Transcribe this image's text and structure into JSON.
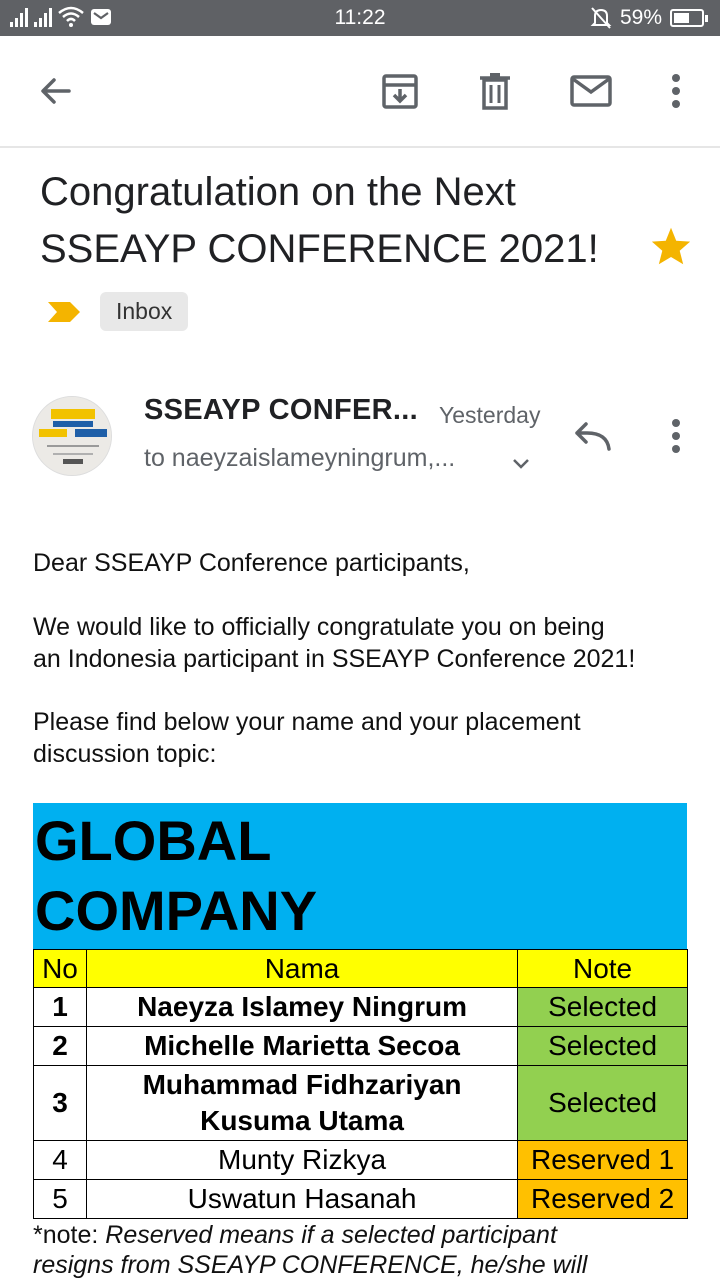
{
  "status_bar": {
    "time": "11:22",
    "battery": "59%",
    "battery_level": 0.59
  },
  "app_bar": {
    "icons": [
      "back-arrow-icon",
      "archive-icon",
      "delete-icon",
      "mark-unread-icon",
      "more-options-icon"
    ]
  },
  "email": {
    "subject_line1": "Congratulation on the Next",
    "subject_line2": "SSEAYP CONFERENCE 2021!",
    "starred": true,
    "label": "Inbox",
    "sender": "SSEAYP CONFER...",
    "date": "Yesterday",
    "to": "to naeyzaislameyningrum,..."
  },
  "body": {
    "greeting": "Dear SSEAYP Conference participants,",
    "para1_line1": "We would like to officially congratulate you on being",
    "para1_line2": "an Indonesia participant in SSEAYP Conference 2021!",
    "para2_line1": "Please find below your name and your placement",
    "para2_line2": "discussion topic:"
  },
  "table": {
    "title_line1": "GLOBAL",
    "title_line2": "COMPANY",
    "headers": {
      "no": "No",
      "name": "Nama",
      "note": "Note"
    },
    "rows": [
      {
        "no": "1",
        "name": "Naeyza Islamey Ningrum",
        "note": "Selected"
      },
      {
        "no": "2",
        "name": "Michelle Marietta Secoa",
        "note": "Selected"
      },
      {
        "no": "3",
        "name_line1": "Muhammad Fidhzariyan",
        "name_line2": "Kusuma Utama",
        "note": "Selected"
      },
      {
        "no": "4",
        "name": "Munty Rizkya",
        "note": "Reserved 1"
      },
      {
        "no": "5",
        "name": "Uswatun Hasanah",
        "note": "Reserved 2"
      }
    ]
  },
  "footnote": {
    "prefix": "*note: ",
    "line1_italic": "Reserved means if a selected participant",
    "line2_italic": "resigns from SSEAYP CONFERENCE, he/she will"
  },
  "colors": {
    "status_bar": "#5f6165",
    "star": "#f4b400",
    "label_marker": "#f4b400",
    "title_block": "#00b0f0",
    "header_row": "#ffff00",
    "selected": "#92d050",
    "reserved": "#ffc000"
  }
}
